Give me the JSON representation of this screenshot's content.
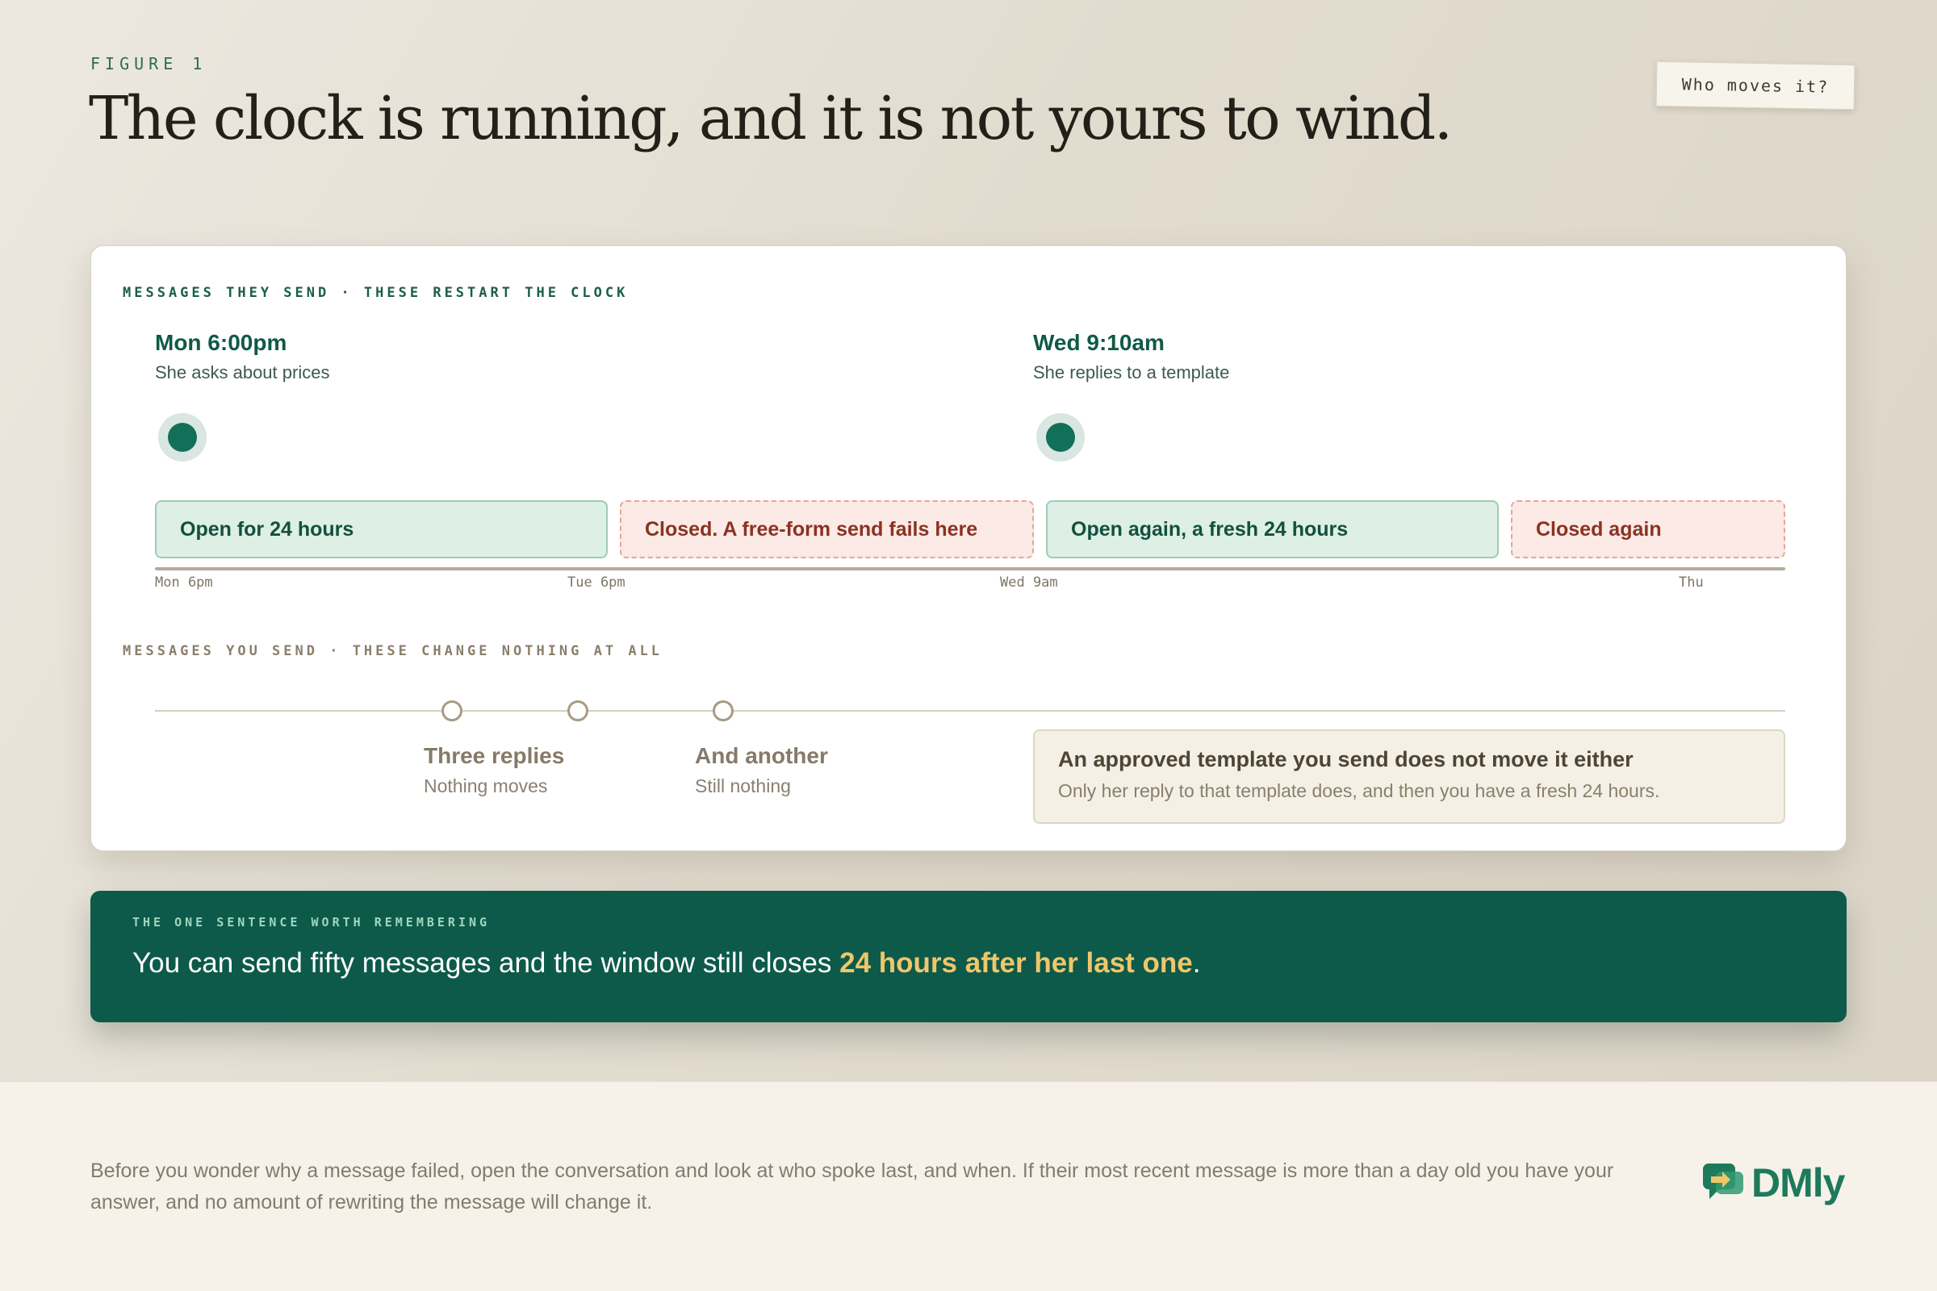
{
  "header": {
    "figure_label": "FIGURE 1",
    "headline": "The clock is running, and it is not yours to wind.",
    "sticker": "Who moves it?"
  },
  "timeline": {
    "they_label": "MESSAGES THEY SEND · THESE RESTART THE CLOCK",
    "events": [
      {
        "time": "Mon 6:00pm",
        "desc": "She asks about prices"
      },
      {
        "time": "Wed 9:10am",
        "desc": "She replies to a template"
      }
    ],
    "segments": [
      {
        "label": "Open for 24 hours",
        "state": "open"
      },
      {
        "label": "Closed. A free-form send fails here",
        "state": "closed"
      },
      {
        "label": "Open again, a fresh 24 hours",
        "state": "open"
      },
      {
        "label": "Closed again",
        "state": "closed"
      }
    ],
    "ticks": [
      "Mon 6pm",
      "Tue 6pm",
      "Wed 9am",
      "Thu"
    ],
    "you_label": "MESSAGES YOU SEND · THESE CHANGE NOTHING AT ALL",
    "you_events": [
      {
        "title": "Three replies",
        "desc": "Nothing moves"
      },
      {
        "title": "And another",
        "desc": "Still nothing"
      }
    ],
    "note": {
      "title": "An approved template you send does not move it either",
      "desc": "Only her reply to that template does, and then you have a fresh 24 hours."
    }
  },
  "banner": {
    "label": "THE ONE SENTENCE WORTH REMEMBERING",
    "sentence_start": "You can send fifty messages and the window still closes ",
    "sentence_highlight": "24 hours after her last one",
    "sentence_end": "."
  },
  "footer": {
    "text": "Before you wonder why a message failed, open the conversation and look at who spoke last, and when. If their most recent message is more than a day old you have your answer, and no amount of rewriting the message will change it.",
    "logo_text": "DMly"
  },
  "colors": {
    "brand_green": "#0d5a4b",
    "open_fill": "#deefe5",
    "closed_fill": "#fbeae6",
    "highlight": "#f0c66a"
  }
}
